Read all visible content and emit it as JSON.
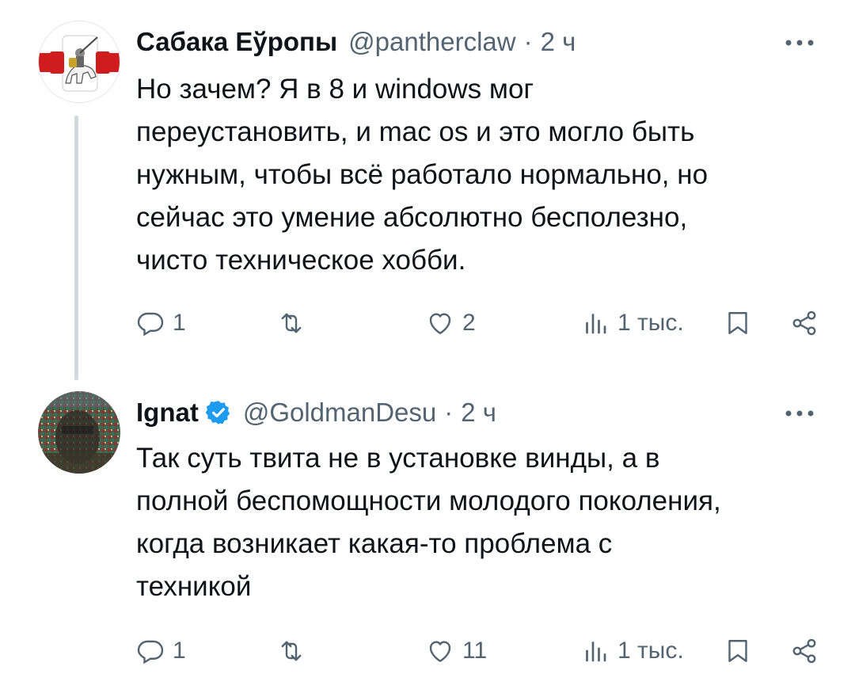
{
  "tweets": [
    {
      "name": "Сабака Еўропы",
      "handle": "@pantherclaw",
      "separator": "·",
      "time": "2 ч",
      "text": "Но зачем? Я в 8 и windows мог\nпереустановить, и mac os и это могло быть\nнужным, чтобы всё работало нормально, но\nсейчас это умение абсолютно бесполезно,\nчисто техническое хобби.",
      "verified": false,
      "avatar_icon": "pahonia-coat-of-arms-avatar",
      "actions": {
        "replies": "1",
        "retweets": "",
        "likes": "2",
        "views": "1 тыс."
      }
    },
    {
      "name": "Ignat",
      "handle": "@GoldmanDesu",
      "separator": "·",
      "time": "2 ч",
      "text": "Так суть твита не в установке винды, а в\nполной беспомощности молодого поколения,\nкогда возникает какая-то проблема с\nтехникой",
      "verified": true,
      "avatar_icon": "glitch-portrait-avatar",
      "actions": {
        "replies": "1",
        "retweets": "",
        "likes": "11",
        "views": "1 тыс."
      }
    }
  ],
  "colors": {
    "text": "#0f1419",
    "secondary": "#536471",
    "verified_blue": "#1d9bf0",
    "thread_line": "#cfd9de"
  },
  "icons": [
    "reply-icon",
    "retweet-icon",
    "like-icon",
    "views-icon",
    "bookmark-icon",
    "share-icon",
    "more-icon",
    "verified-badge-icon"
  ]
}
